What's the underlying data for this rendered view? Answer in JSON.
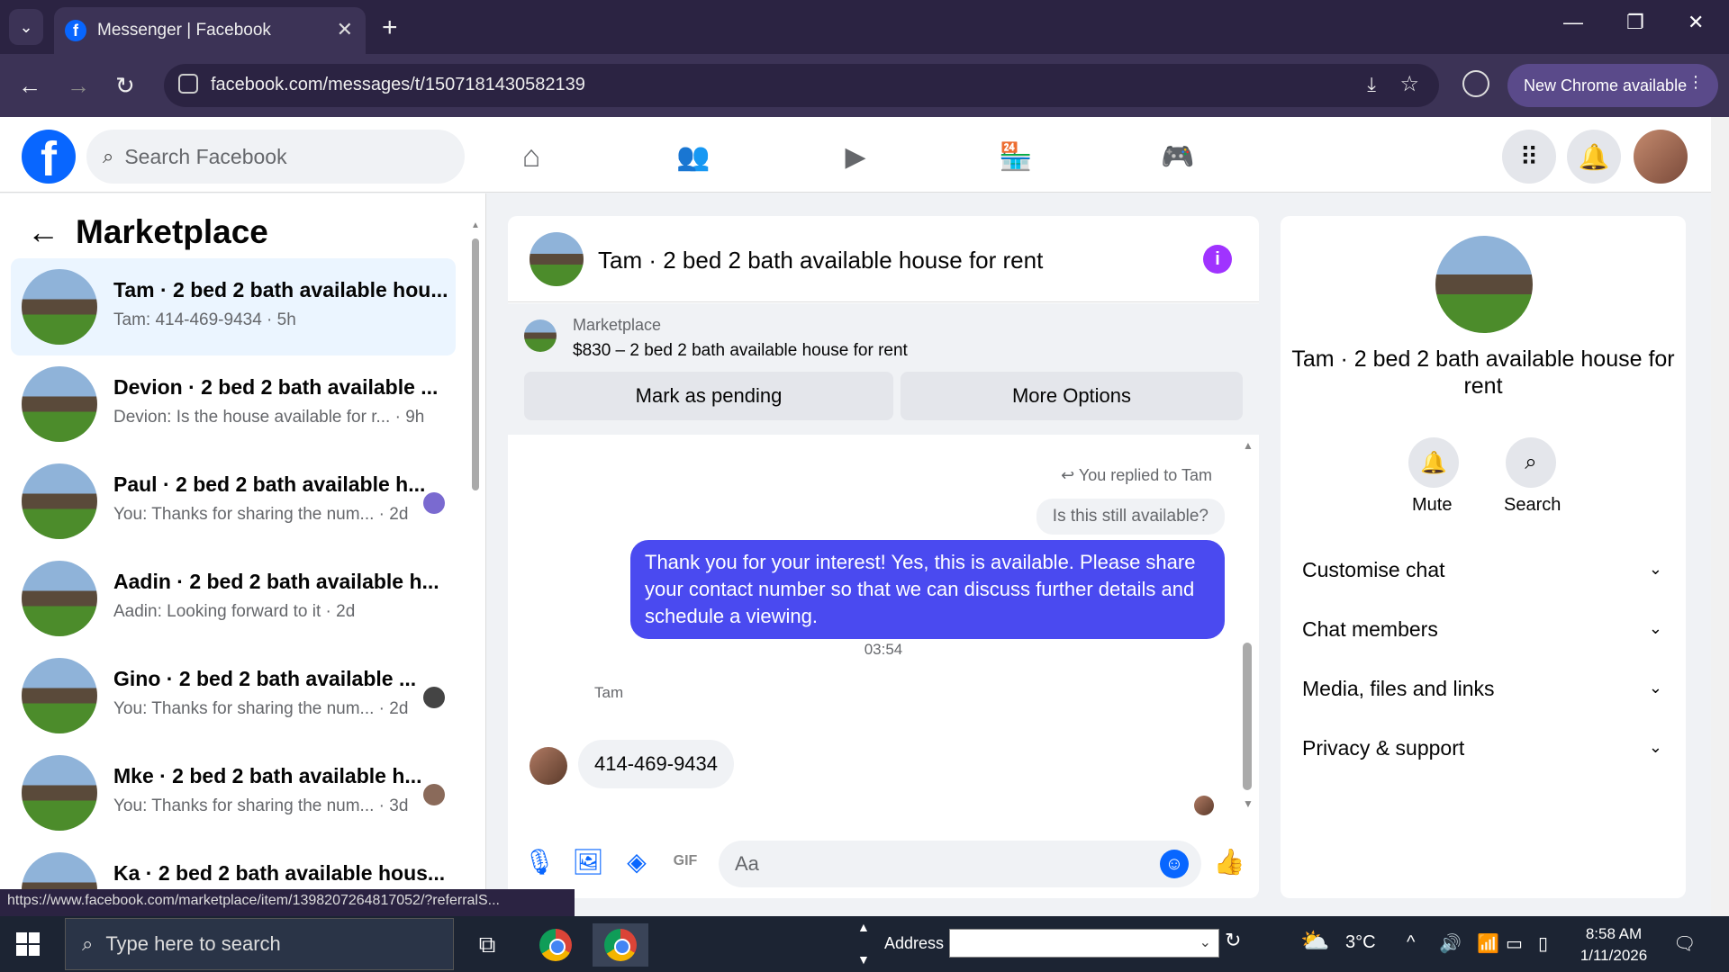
{
  "browser": {
    "tab_title": "Messenger | Facebook",
    "url": "facebook.com/messages/t/1507181430582139",
    "new_chrome": "New Chrome available",
    "status_url": "https://www.facebook.com/marketplace/item/1398207264817052/?referralS..."
  },
  "fb": {
    "search_placeholder": "Search Facebook"
  },
  "left": {
    "title": "Marketplace",
    "conversations": [
      {
        "name": "Tam · 2 bed 2 bath available hou...",
        "sub": "Tam: 414-469-9434 · 5h"
      },
      {
        "name": "Devion · 2 bed 2 bath available ...",
        "sub": "Devion: Is the house available for r... · 9h"
      },
      {
        "name": "Paul · 2 bed 2 bath available h...",
        "sub": "You: Thanks for sharing the num... · 2d"
      },
      {
        "name": "Aadin · 2 bed 2 bath available h...",
        "sub": "Aadin: Looking forward to it · 2d"
      },
      {
        "name": "Gino · 2 bed 2 bath available ...",
        "sub": "You: Thanks for sharing the num... · 2d"
      },
      {
        "name": "Mke · 2 bed 2 bath available h...",
        "sub": "You: Thanks for sharing the num... · 3d"
      },
      {
        "name": "Ka · 2 bed 2 bath available hous...",
        "sub": ""
      }
    ]
  },
  "chat": {
    "title": "Tam · 2 bed 2 bath available house for rent",
    "mp_label": "Marketplace",
    "mp_price": "$830 – 2 bed 2 bath available house for rent",
    "btn_pending": "Mark as pending",
    "btn_more": "More Options",
    "replied": "You replied to Tam",
    "quote": "Is this still available?",
    "out_message": "Thank you for your interest! Yes, this is available. Please share your contact number so that we can discuss further details and schedule a viewing.",
    "time": "03:54",
    "sender": "Tam",
    "in_message": "414-469-9434",
    "input_placeholder": "Aa"
  },
  "right": {
    "title": "Tam · 2 bed 2 bath available house for rent",
    "mute": "Mute",
    "search": "Search",
    "rows": [
      "Customise chat",
      "Chat members",
      "Media, files and links",
      "Privacy & support"
    ]
  },
  "taskbar": {
    "search_placeholder": "Type here to search",
    "address_label": "Address",
    "temp": "3°C",
    "time": "8:58 AM",
    "date": "1/11/2026"
  }
}
